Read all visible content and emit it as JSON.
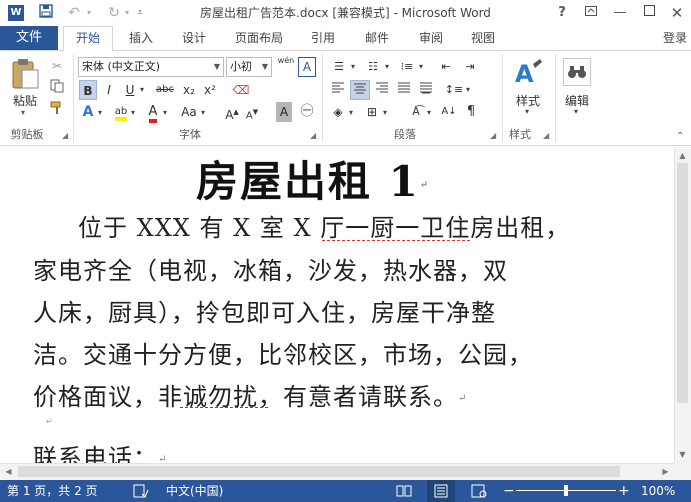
{
  "window": {
    "title": "房屋出租广告范本.docx [兼容模式] - Microsoft Word",
    "help_label": "?",
    "signin_label": "登录"
  },
  "tabs": {
    "file": "文件",
    "items": [
      "开始",
      "插入",
      "设计",
      "页面布局",
      "引用",
      "邮件",
      "审阅",
      "视图"
    ],
    "active": "开始"
  },
  "ribbon": {
    "clipboard": {
      "label": "剪贴板",
      "paste": "粘贴"
    },
    "font": {
      "label": "字体",
      "family": "宋体 (中文正文)",
      "size": "小初",
      "bold": "B",
      "italic": "I",
      "underline": "U",
      "strike": "abc",
      "subscript": "x₂",
      "superscript": "x²",
      "wen": "wén",
      "A": "A",
      "aa": "Aa"
    },
    "paragraph": {
      "label": "段落"
    },
    "styles": {
      "label": "样式",
      "button": "样式"
    },
    "editing": {
      "button": "编辑"
    }
  },
  "document": {
    "title": "房屋出租 1",
    "lines": [
      "位于 XXX 有 X 室 X 厅一厨一卫住房出租，",
      "家电齐全（电视，冰箱，沙发，热水器，双",
      "人床，厨具），拎包即可入住，房屋干净整",
      "洁。交通十分方便，比邻校区，市场，公园，",
      "价格面议，非诚勿扰，有意者请联系。"
    ],
    "contact": "联系电话："
  },
  "status": {
    "page": "第 1 页，共 2 页",
    "language": "中文(中国)",
    "zoom": "100%",
    "zoom_level": 100
  },
  "colors": {
    "accent": "#2b579a",
    "squiggle_red": "#d33",
    "squiggle_blue": "#3355cc"
  }
}
